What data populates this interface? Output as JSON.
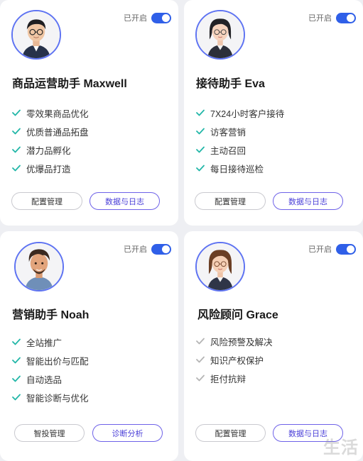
{
  "colors": {
    "accent": "#2f5fe8",
    "check_active": "#23b7a8",
    "check_inactive": "#b5b5b5",
    "primary_button": "#6e62e8"
  },
  "cards": [
    {
      "toggle_label": "已开启",
      "toggle_on": true,
      "title": "商品运营助手 Maxwell",
      "features": [
        "零效果商品优化",
        "优质普通品拓盘",
        "潜力品孵化",
        "优爆品打造"
      ],
      "features_active": true,
      "button_secondary": "配置管理",
      "button_primary": "数据与日志"
    },
    {
      "toggle_label": "已开启",
      "toggle_on": true,
      "title": "接待助手 Eva",
      "features": [
        "7X24小时客户接待",
        "访客营销",
        "主动召回",
        "每日接待巡检"
      ],
      "features_active": true,
      "button_secondary": "配置管理",
      "button_primary": "数据与日志"
    },
    {
      "toggle_label": "已开启",
      "toggle_on": true,
      "title": "营销助手 Noah",
      "features": [
        "全站推广",
        "智能出价与匹配",
        "自动选品",
        "智能诊断与优化"
      ],
      "features_active": true,
      "button_secondary": "智投管理",
      "button_primary": "诊断分析"
    },
    {
      "toggle_label": "已开启",
      "toggle_on": true,
      "title": "风险顾问 Grace",
      "features": [
        "风险预警及解决",
        "知识产权保护",
        "拒付抗辩"
      ],
      "features_active": false,
      "button_secondary": "配置管理",
      "button_primary": "数据与日志"
    }
  ],
  "watermark": "生活"
}
